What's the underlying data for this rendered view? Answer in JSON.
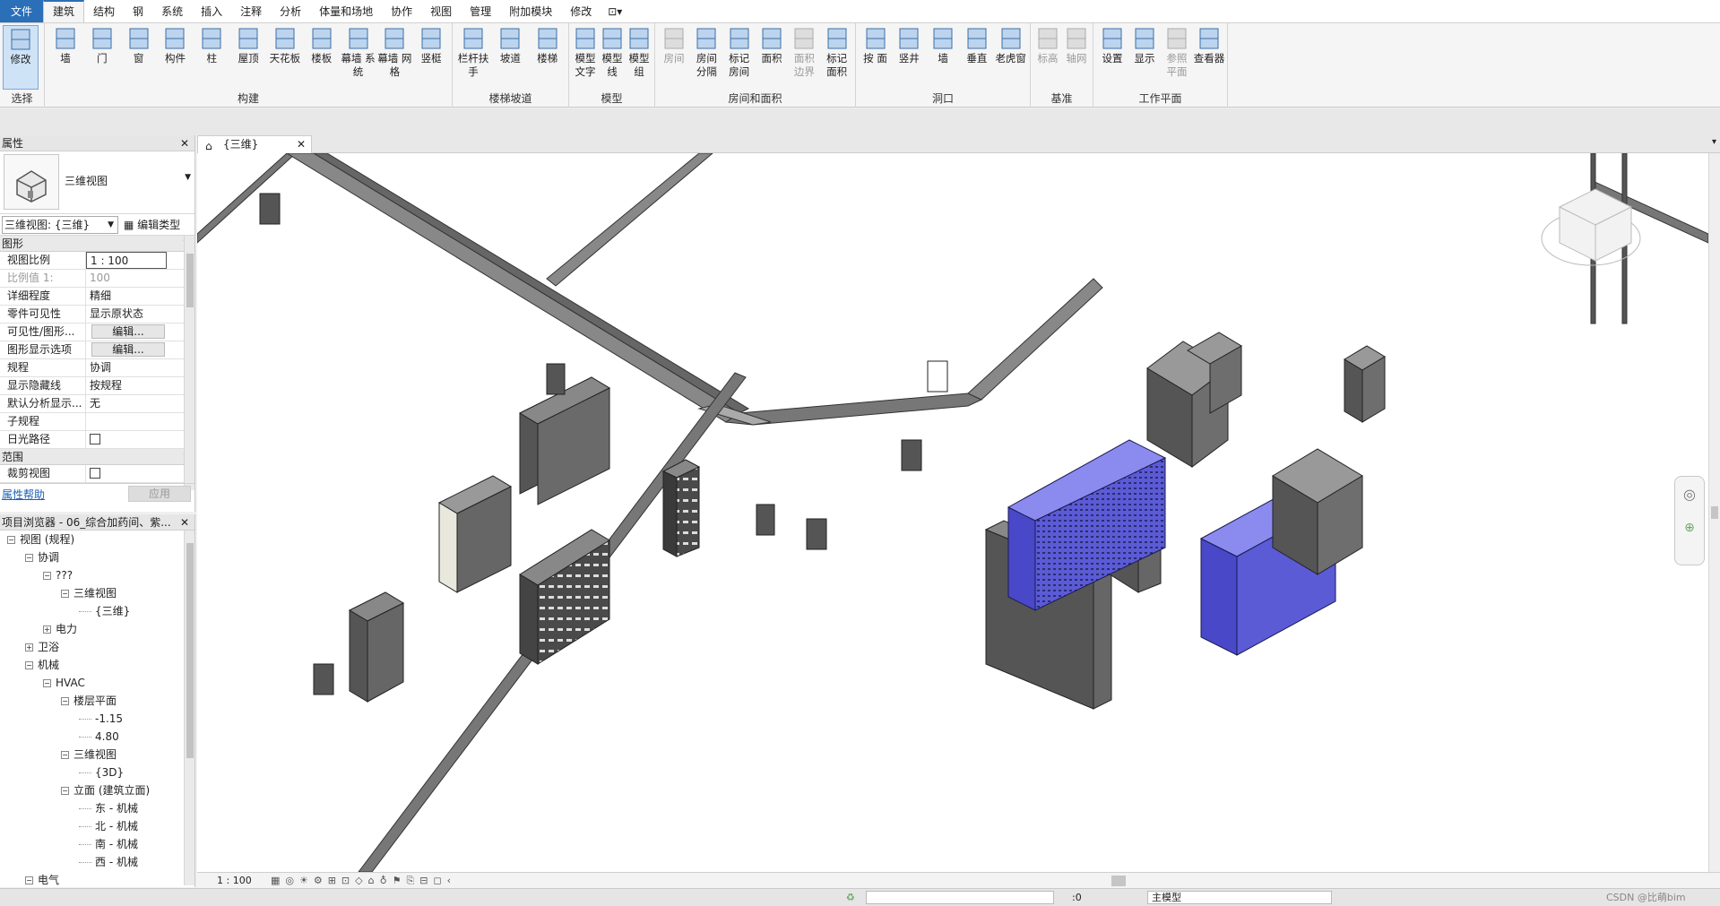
{
  "menubar": {
    "items": [
      "文件",
      "建筑",
      "结构",
      "钢",
      "系统",
      "插入",
      "注释",
      "分析",
      "体量和场地",
      "协作",
      "视图",
      "管理",
      "附加模块",
      "修改"
    ],
    "active": "建筑"
  },
  "ribbon": {
    "groups": [
      {
        "title": "选择",
        "buttons": [
          {
            "label": "修改",
            "icon": "cursor-icon"
          }
        ]
      },
      {
        "title": "构建",
        "buttons": [
          {
            "label": "墙",
            "icon": "wall-icon"
          },
          {
            "label": "门",
            "icon": "door-icon"
          },
          {
            "label": "窗",
            "icon": "window-icon"
          },
          {
            "label": "构件",
            "icon": "component-icon"
          },
          {
            "label": "柱",
            "icon": "column-icon"
          },
          {
            "label": "屋顶",
            "icon": "roof-icon"
          },
          {
            "label": "天花板",
            "icon": "ceiling-icon"
          },
          {
            "label": "楼板",
            "icon": "floor-icon"
          },
          {
            "label": "幕墙 系统",
            "icon": "curtain-system-icon"
          },
          {
            "label": "幕墙 网格",
            "icon": "curtain-grid-icon"
          },
          {
            "label": "竖梃",
            "icon": "mullion-icon"
          }
        ]
      },
      {
        "title": "楼梯坡道",
        "buttons": [
          {
            "label": "栏杆扶手",
            "icon": "railing-icon"
          },
          {
            "label": "坡道",
            "icon": "ramp-icon"
          },
          {
            "label": "楼梯",
            "icon": "stair-icon"
          }
        ]
      },
      {
        "title": "模型",
        "buttons": [
          {
            "label": "模型 文字",
            "icon": "model-text-icon"
          },
          {
            "label": "模型 线",
            "icon": "model-line-icon"
          },
          {
            "label": "模型 组",
            "icon": "model-group-icon"
          }
        ]
      },
      {
        "title": "房间和面积",
        "buttons": [
          {
            "label": "房间",
            "icon": "room-icon",
            "dim": true
          },
          {
            "label": "房间 分隔",
            "icon": "room-separator-icon"
          },
          {
            "label": "标记 房间",
            "icon": "tag-room-icon"
          },
          {
            "label": "面积",
            "icon": "area-icon"
          },
          {
            "label": "面积 边界",
            "icon": "area-boundary-icon",
            "dim": true
          },
          {
            "label": "标记 面积",
            "icon": "tag-area-icon"
          }
        ]
      },
      {
        "title": "洞口",
        "buttons": [
          {
            "label": "按 面",
            "icon": "by-face-icon"
          },
          {
            "label": "竖井",
            "icon": "shaft-icon"
          },
          {
            "label": "墙",
            "icon": "wall-opening-icon"
          },
          {
            "label": "垂直",
            "icon": "vertical-opening-icon"
          },
          {
            "label": "老虎窗",
            "icon": "dormer-icon"
          }
        ]
      },
      {
        "title": "基准",
        "buttons": [
          {
            "label": "标高",
            "icon": "level-icon",
            "dim": true
          },
          {
            "label": "轴网",
            "icon": "grid-icon",
            "dim": true
          }
        ]
      },
      {
        "title": "工作平面",
        "buttons": [
          {
            "label": "设置",
            "icon": "set-workplane-icon"
          },
          {
            "label": "显示",
            "icon": "show-workplane-icon"
          },
          {
            "label": "参照 平面",
            "icon": "ref-plane-icon",
            "dim": true
          },
          {
            "label": "查看器",
            "icon": "viewer-icon"
          }
        ]
      }
    ]
  },
  "properties": {
    "title": "属性",
    "type_name": "三维视图",
    "selector": "三维视图: {三维}",
    "edit_type": "编辑类型",
    "category1": "图形",
    "rows": [
      {
        "k": "视图比例",
        "v": "1 : 100",
        "style": "box"
      },
      {
        "k": "比例值 1:",
        "v": "100",
        "style": "dim"
      },
      {
        "k": "详细程度",
        "v": "精细"
      },
      {
        "k": "零件可见性",
        "v": "显示原状态"
      },
      {
        "k": "可见性/图形...",
        "v": "编辑...",
        "style": "btn"
      },
      {
        "k": "图形显示选项",
        "v": "编辑...",
        "style": "btn"
      },
      {
        "k": "规程",
        "v": "协调"
      },
      {
        "k": "显示隐藏线",
        "v": "按规程"
      },
      {
        "k": "默认分析显示...",
        "v": "无"
      },
      {
        "k": "子规程",
        "v": ""
      },
      {
        "k": "日光路径",
        "v": "",
        "style": "check"
      }
    ],
    "category2": "范围",
    "rows2": [
      {
        "k": "裁剪视图",
        "v": "",
        "style": "check"
      }
    ],
    "help": "属性帮助",
    "apply": "应用"
  },
  "browser": {
    "title": "项目浏览器 - 06_综合加药间、紫...",
    "nodes": [
      {
        "t": "视图 (规程)",
        "d": 0,
        "tg": "−"
      },
      {
        "t": "协调",
        "d": 1,
        "tg": "−"
      },
      {
        "t": "???",
        "d": 2,
        "tg": "−"
      },
      {
        "t": "三维视图",
        "d": 3,
        "tg": "−"
      },
      {
        "t": "{三维}",
        "d": 4,
        "tg": ""
      },
      {
        "t": "电力",
        "d": 2,
        "tg": "+"
      },
      {
        "t": "卫浴",
        "d": 1,
        "tg": "+"
      },
      {
        "t": "机械",
        "d": 1,
        "tg": "−"
      },
      {
        "t": "HVAC",
        "d": 2,
        "tg": "−"
      },
      {
        "t": "楼层平面",
        "d": 3,
        "tg": "−"
      },
      {
        "t": "-1.15",
        "d": 4,
        "tg": ""
      },
      {
        "t": "4.80",
        "d": 4,
        "tg": ""
      },
      {
        "t": "三维视图",
        "d": 3,
        "tg": "−"
      },
      {
        "t": "{3D}",
        "d": 4,
        "tg": ""
      },
      {
        "t": "立面 (建筑立面)",
        "d": 3,
        "tg": "−"
      },
      {
        "t": "东 - 机械",
        "d": 4,
        "tg": ""
      },
      {
        "t": "北 - 机械",
        "d": 4,
        "tg": ""
      },
      {
        "t": "南 - 机械",
        "d": 4,
        "tg": ""
      },
      {
        "t": "西 - 机械",
        "d": 4,
        "tg": ""
      },
      {
        "t": "电气",
        "d": 1,
        "tg": "−"
      }
    ]
  },
  "view_tab": {
    "label": "{三维}"
  },
  "status": {
    "scale": "1 : 100",
    "zero": ":0",
    "model": "主模型",
    "watermark": "CSDN @比萌bim"
  },
  "colors": {
    "accent": "#2a6fb7",
    "equipment_blue": "#5b5bd6",
    "equipment_gray": "#6e6e6e"
  }
}
